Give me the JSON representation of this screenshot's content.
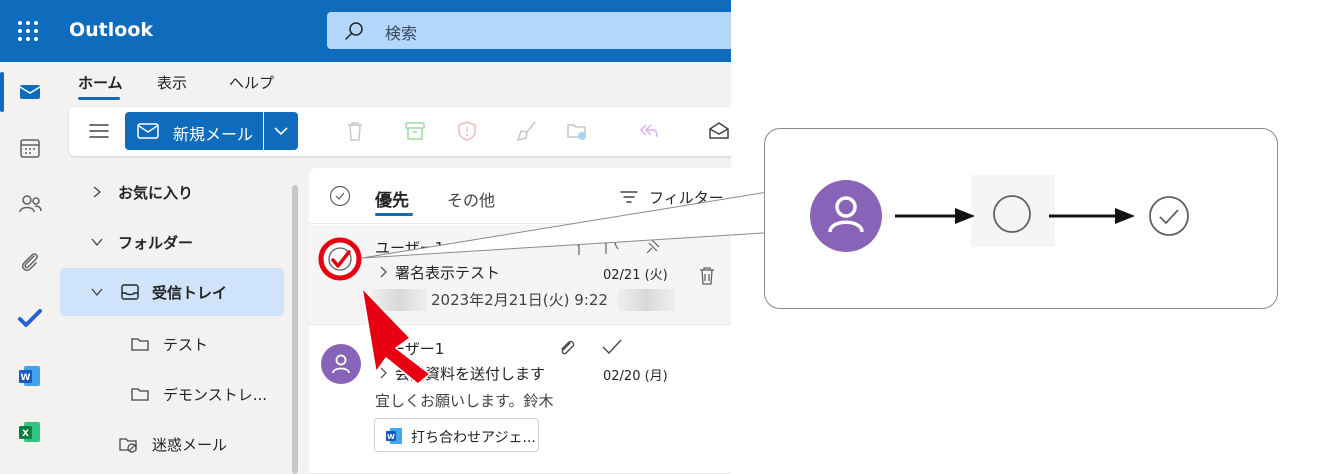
{
  "app": {
    "title": "Outlook"
  },
  "search": {
    "placeholder": "検索"
  },
  "ribbon": {
    "tabs": [
      {
        "label": "ホーム",
        "active": true
      },
      {
        "label": "表示",
        "active": false
      },
      {
        "label": "ヘルプ",
        "active": false
      }
    ],
    "new_mail_label": "新規メール"
  },
  "folders": {
    "items": [
      {
        "label": "お気に入り",
        "icon": "chevron-right-icon"
      },
      {
        "label": "フォルダー",
        "icon": "chevron-down-icon"
      },
      {
        "label": "受信トレイ",
        "icon": "inbox-icon",
        "selected": true
      },
      {
        "label": "テスト",
        "icon": "folder-icon"
      },
      {
        "label": "デモンストレ...",
        "icon": "folder-icon"
      },
      {
        "label": "迷惑メール",
        "icon": "junk-folder-icon"
      }
    ]
  },
  "message_list": {
    "tabs": {
      "focused": "優先",
      "other": "その他"
    },
    "filter_label": "フィルター",
    "messages": [
      {
        "sender": "ユーザー1",
        "subject": "署名表示テスト",
        "date": "02/21 (火)",
        "preview": "2023年2月21日(火) 9:22",
        "selected_check": true
      },
      {
        "sender": "ユーザー1",
        "subject": "会議資料を送付します",
        "date": "02/20 (月)",
        "preview": "宜しくお願いします。鈴木",
        "attachment": "打ち合わせアジェ..."
      }
    ]
  },
  "colors": {
    "brand": "#0f6cbd",
    "avatar": "#8764b8",
    "annotation": "#e60012"
  }
}
